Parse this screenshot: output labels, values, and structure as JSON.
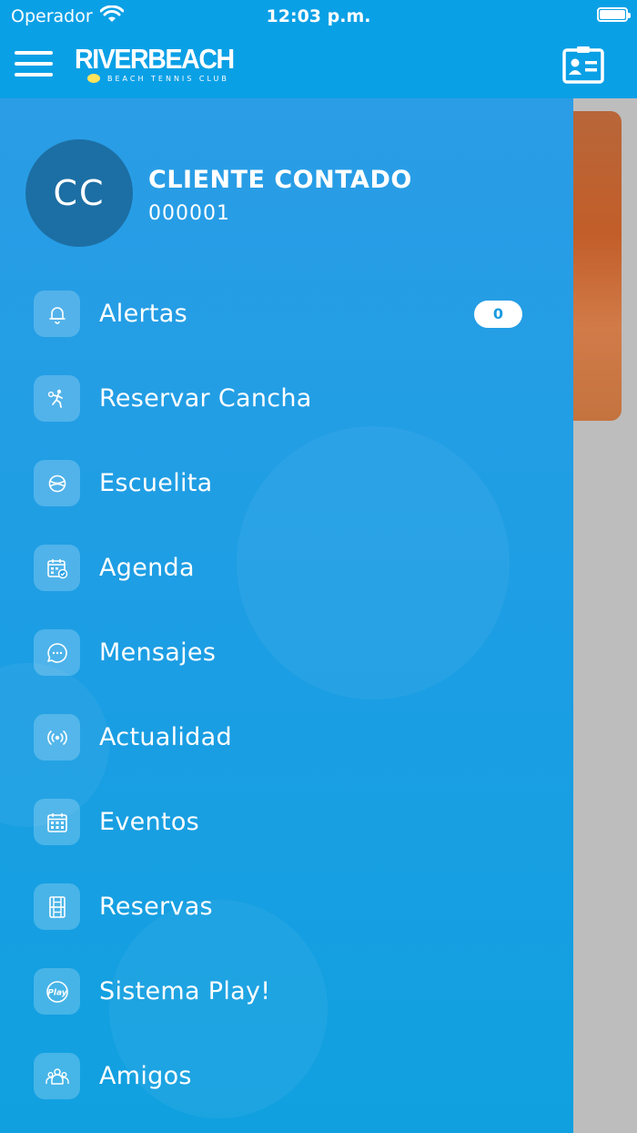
{
  "status": {
    "carrier": "Operador",
    "time": "12:03 p.m."
  },
  "header": {
    "logo_word": "RIVERBEACH",
    "logo_tagline": "BEACH TENNIS CLUB"
  },
  "user": {
    "initials": "CC",
    "name": "CLIENTE CONTADO",
    "id": "000001"
  },
  "menu": {
    "items": [
      {
        "label": "Alertas",
        "icon": "bell-icon",
        "badge": "0"
      },
      {
        "label": "Reservar Cancha",
        "icon": "tennis-player-icon"
      },
      {
        "label": "Escuelita",
        "icon": "ball-icon"
      },
      {
        "label": "Agenda",
        "icon": "calendar-check-icon"
      },
      {
        "label": "Mensajes",
        "icon": "chat-bubble-icon"
      },
      {
        "label": "Actualidad",
        "icon": "broadcast-icon"
      },
      {
        "label": "Eventos",
        "icon": "calendar-grid-icon"
      },
      {
        "label": "Reservas",
        "icon": "court-icon"
      },
      {
        "label": "Sistema Play!",
        "icon": "play-icon",
        "icon_text": "Play"
      },
      {
        "label": "Amigos",
        "icon": "friends-icon"
      }
    ]
  },
  "colors": {
    "primary": "#0aa0e6",
    "avatar": "#1c6fa4",
    "badge_text": "#1a9ae0"
  }
}
